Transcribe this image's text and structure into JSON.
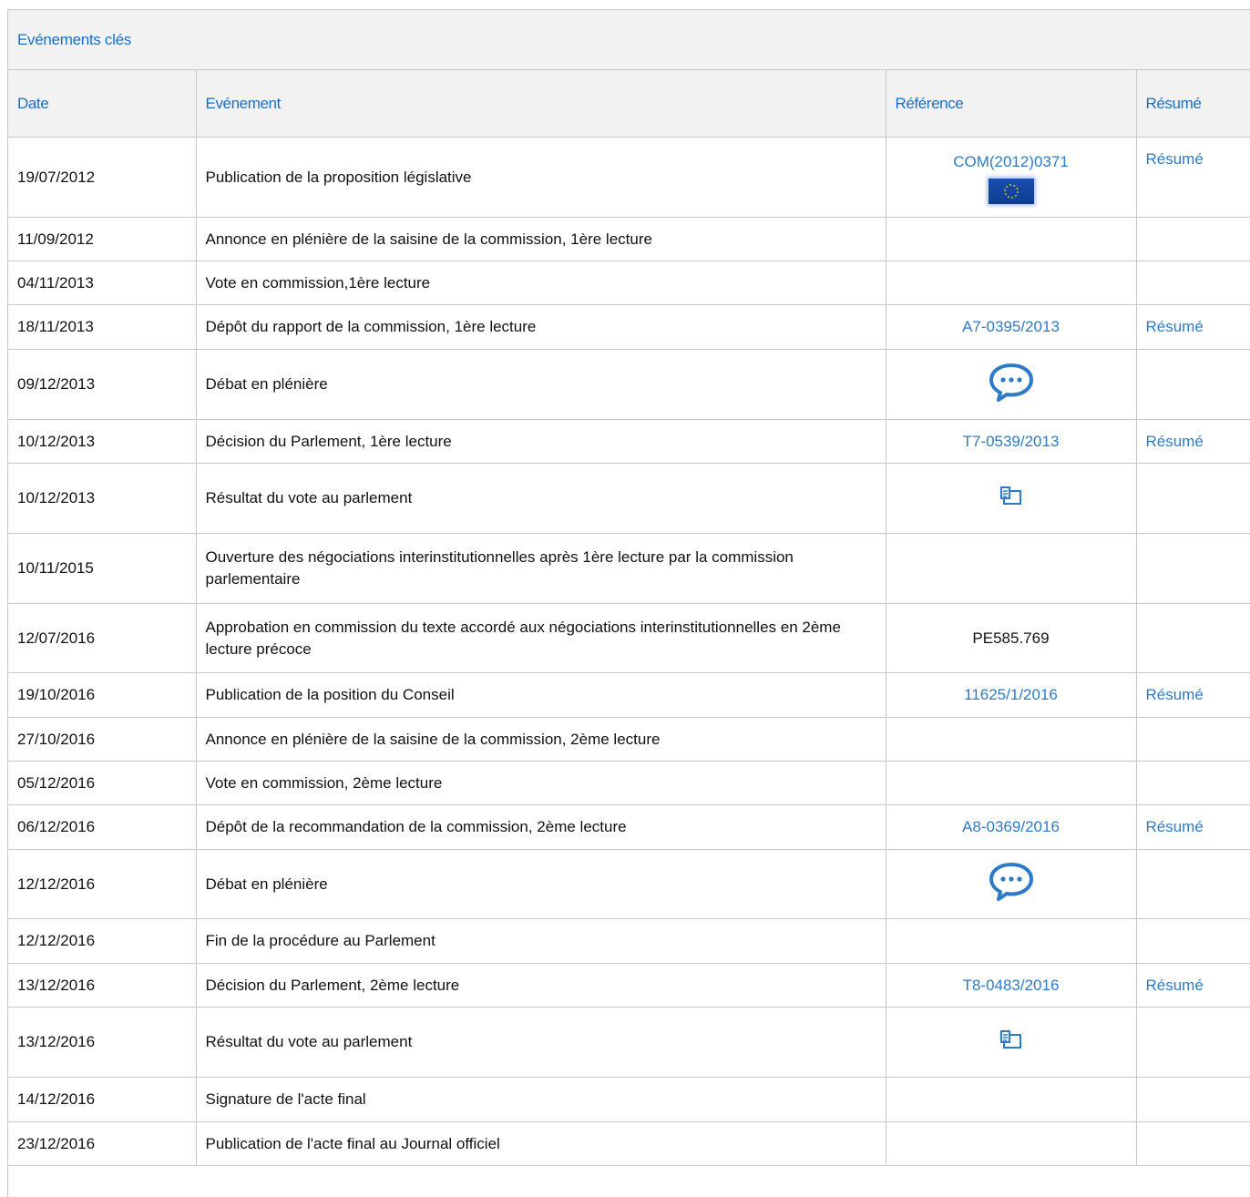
{
  "panel": {
    "title": "Evénements clés"
  },
  "columns": {
    "date": "Date",
    "event": "Evénement",
    "reference": "Référence",
    "summary": "Résumé"
  },
  "rows": [
    {
      "date": "19/07/2012",
      "event": "Publication de la proposition législative",
      "reference": "COM(2012)0371",
      "ref_icon": "eu-flag-icon",
      "summary": "Résumé"
    },
    {
      "date": "11/09/2012",
      "event": "Annonce en plénière de la saisine de la commission, 1ère lecture",
      "reference": "",
      "summary": ""
    },
    {
      "date": "04/11/2013",
      "event": "Vote en commission,1ère lecture",
      "reference": "",
      "summary": ""
    },
    {
      "date": "18/11/2013",
      "event": "Dépôt du rapport de la commission, 1ère lecture",
      "reference": "A7-0395/2013",
      "summary": "Résumé"
    },
    {
      "date": "09/12/2013",
      "event": "Débat en plénière",
      "ref_icon": "speech-bubble-icon",
      "summary": ""
    },
    {
      "date": "10/12/2013",
      "event": "Décision du Parlement, 1ère lecture",
      "reference": "T7-0539/2013",
      "summary": "Résumé"
    },
    {
      "date": "10/12/2013",
      "event": "Résultat du vote au parlement",
      "ref_icon": "vote-icon",
      "summary": ""
    },
    {
      "date": "10/11/2015",
      "event": "Ouverture des négociations interinstitutionnelles après 1ère lecture par la commission parlementaire",
      "reference": "",
      "summary": ""
    },
    {
      "date": "12/07/2016",
      "event": "Approbation en commission du texte accordé aux négociations interinstitutionnelles en 2ème lecture précoce",
      "reference_plain": "PE585.769",
      "summary": ""
    },
    {
      "date": "19/10/2016",
      "event": "Publication de la position du Conseil",
      "reference": "11625/1/2016",
      "summary": "Résumé"
    },
    {
      "date": "27/10/2016",
      "event": "Annonce en plénière de la saisine de la commission, 2ème lecture",
      "reference": "",
      "summary": ""
    },
    {
      "date": "05/12/2016",
      "event": "Vote en commission, 2ème lecture",
      "reference": "",
      "summary": ""
    },
    {
      "date": "06/12/2016",
      "event": "Dépôt de la recommandation de la commission, 2ème lecture",
      "reference": "A8-0369/2016",
      "summary": "Résumé"
    },
    {
      "date": "12/12/2016",
      "event": "Débat en plénière",
      "ref_icon": "speech-bubble-icon",
      "summary": ""
    },
    {
      "date": "12/12/2016",
      "event": "Fin de la procédure au Parlement",
      "reference": "",
      "summary": ""
    },
    {
      "date": "13/12/2016",
      "event": "Décision du Parlement, 2ème lecture",
      "reference": "T8-0483/2016",
      "summary": "Résumé"
    },
    {
      "date": "13/12/2016",
      "event": "Résultat du vote au parlement",
      "ref_icon": "vote-icon",
      "summary": ""
    },
    {
      "date": "14/12/2016",
      "event": "Signature de l'acte final",
      "reference": "",
      "summary": ""
    },
    {
      "date": "23/12/2016",
      "event": "Publication de l'acte final au Journal officiel",
      "reference": "",
      "summary": ""
    }
  ],
  "colors": {
    "link": "#2d7bc8",
    "header_text": "#1a6fc4",
    "header_bg": "#f2f2f2",
    "border": "#c8c8c8"
  }
}
